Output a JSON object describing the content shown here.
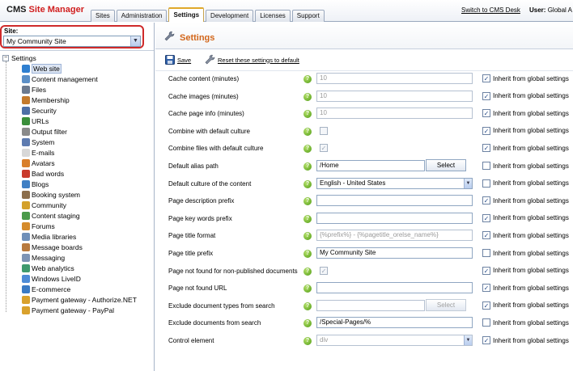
{
  "header": {
    "logo_prefix": "CMS",
    "logo_suffix": "Site Manager",
    "tabs": [
      {
        "label": "Sites",
        "active": false
      },
      {
        "label": "Administration",
        "active": false
      },
      {
        "label": "Settings",
        "active": true
      },
      {
        "label": "Development",
        "active": false
      },
      {
        "label": "Licenses",
        "active": false
      },
      {
        "label": "Support",
        "active": false
      }
    ],
    "switch_link": "Switch to CMS Desk",
    "user_label": "User:",
    "user_name": "Global A"
  },
  "site": {
    "label": "Site:",
    "selected": "My Community Site"
  },
  "tree": {
    "root": "Settings",
    "items": [
      {
        "label": "Web site",
        "icon": "globe-icon",
        "color": "#2f7fd0",
        "selected": true
      },
      {
        "label": "Content management",
        "icon": "content-icon",
        "color": "#5b8fc7"
      },
      {
        "label": "Files",
        "icon": "files-icon",
        "color": "#6c7a8f"
      },
      {
        "label": "Membership",
        "icon": "membership-icon",
        "color": "#c47a2c"
      },
      {
        "label": "Security",
        "icon": "security-icon",
        "color": "#4e6fa6"
      },
      {
        "label": "URLs",
        "icon": "urls-icon",
        "color": "#3a8e3a"
      },
      {
        "label": "Output filter",
        "icon": "filter-icon",
        "color": "#8a8a8a"
      },
      {
        "label": "System",
        "icon": "system-icon",
        "color": "#5d7bb0"
      },
      {
        "label": "E-mails",
        "icon": "email-icon",
        "color": "#d8d8d8"
      },
      {
        "label": "Avatars",
        "icon": "avatar-icon",
        "color": "#d97f2a"
      },
      {
        "label": "Bad words",
        "icon": "badwords-icon",
        "color": "#c93a2c"
      },
      {
        "label": "Blogs",
        "icon": "blogs-icon",
        "color": "#3f7fc4"
      },
      {
        "label": "Booking system",
        "icon": "booking-icon",
        "color": "#8c6e4b"
      },
      {
        "label": "Community",
        "icon": "community-icon",
        "color": "#d4a12b"
      },
      {
        "label": "Content staging",
        "icon": "staging-icon",
        "color": "#4a9a4a"
      },
      {
        "label": "Forums",
        "icon": "forums-icon",
        "color": "#d58b2c"
      },
      {
        "label": "Media libraries",
        "icon": "media-icon",
        "color": "#6f8fb8"
      },
      {
        "label": "Message boards",
        "icon": "boards-icon",
        "color": "#b87a3e"
      },
      {
        "label": "Messaging",
        "icon": "messaging-icon",
        "color": "#7d94b5"
      },
      {
        "label": "Web analytics",
        "icon": "analytics-icon",
        "color": "#3f9a6e"
      },
      {
        "label": "Windows LiveID",
        "icon": "liveid-icon",
        "color": "#4d8bd6"
      },
      {
        "label": "E-commerce",
        "icon": "ecommerce-icon",
        "color": "#3a7ac4"
      },
      {
        "label": "Payment gateway - Authorize.NET",
        "icon": "payment-icon",
        "color": "#d9a12c"
      },
      {
        "label": "Payment gateway - PayPal",
        "icon": "payment-icon",
        "color": "#d9a12c"
      }
    ]
  },
  "main": {
    "title": "Settings",
    "save_label": "Save",
    "reset_label": "Reset these settings to default",
    "inherit_label": "Inherit from global settings",
    "select_label": "Select",
    "rows": [
      {
        "label": "Cache content (minutes)",
        "type": "text",
        "value": "10",
        "disabled": true,
        "inherit": true
      },
      {
        "label": "Cache images (minutes)",
        "type": "text",
        "value": "10",
        "disabled": true,
        "inherit": true
      },
      {
        "label": "Cache page info (minutes)",
        "type": "text",
        "value": "10",
        "disabled": true,
        "inherit": true
      },
      {
        "label": "Combine with default culture",
        "type": "checkbox",
        "value": "",
        "disabled": true,
        "inherit": true
      },
      {
        "label": "Combine files with default culture",
        "type": "checkbox",
        "value": "✓",
        "disabled": true,
        "inherit": true
      },
      {
        "label": "Default alias path",
        "type": "text-select",
        "value": "/Home",
        "disabled": false,
        "inherit": false
      },
      {
        "label": "Default culture of the content",
        "type": "select",
        "value": "English - United States",
        "disabled": false,
        "inherit": false
      },
      {
        "label": "Page description prefix",
        "type": "text",
        "value": "",
        "disabled": false,
        "inherit": true
      },
      {
        "label": "Page key words prefix",
        "type": "text",
        "value": "",
        "disabled": false,
        "inherit": true
      },
      {
        "label": "Page title format",
        "type": "text",
        "value": "{%prefix%} - {%pagetitle_orelse_name%}",
        "disabled": true,
        "inherit": true
      },
      {
        "label": "Page title prefix",
        "type": "text",
        "value": "My Community Site",
        "disabled": false,
        "inherit": false
      },
      {
        "label": "Page not found for non-published documents",
        "type": "checkbox",
        "value": "✓",
        "disabled": true,
        "inherit": true
      },
      {
        "label": "Page not found URL",
        "type": "text",
        "value": "",
        "disabled": false,
        "inherit": true
      },
      {
        "label": "Exclude document types from search",
        "type": "text-select",
        "value": "",
        "disabled": true,
        "inherit": true
      },
      {
        "label": "Exclude documents from search",
        "type": "text",
        "value": "/Special-Pages/%",
        "disabled": false,
        "inherit": false
      },
      {
        "label": "Control element",
        "type": "select",
        "value": "div",
        "disabled": true,
        "inherit": true
      }
    ]
  },
  "colors": {
    "accent_orange": "#d2661a",
    "site_box_red": "#cf2a2a",
    "help_green": "#4e9b12"
  }
}
